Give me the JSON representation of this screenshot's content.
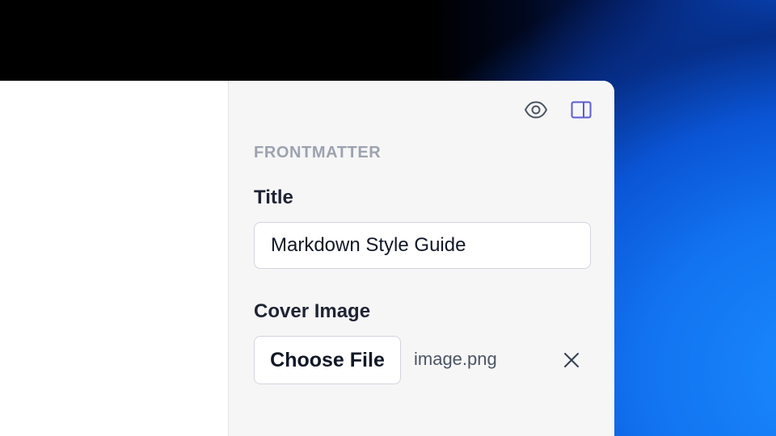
{
  "colors": {
    "accent": "#5b5bd6",
    "panel_bg": "#f6f6f7",
    "heading_muted": "#9ca3af",
    "text_dark": "#1f2433",
    "backdrop_blue": "#1273f0"
  },
  "toolbar": {
    "preview_icon": "eye-icon",
    "sidebar_icon": "sidebar-panel-icon"
  },
  "frontmatter": {
    "heading": "FRONTMATTER",
    "title": {
      "label": "Title",
      "value": "Markdown Style Guide"
    },
    "cover_image": {
      "label": "Cover Image",
      "button_label": "Choose File",
      "file_name": "image.png",
      "clear_icon": "close-icon"
    }
  }
}
